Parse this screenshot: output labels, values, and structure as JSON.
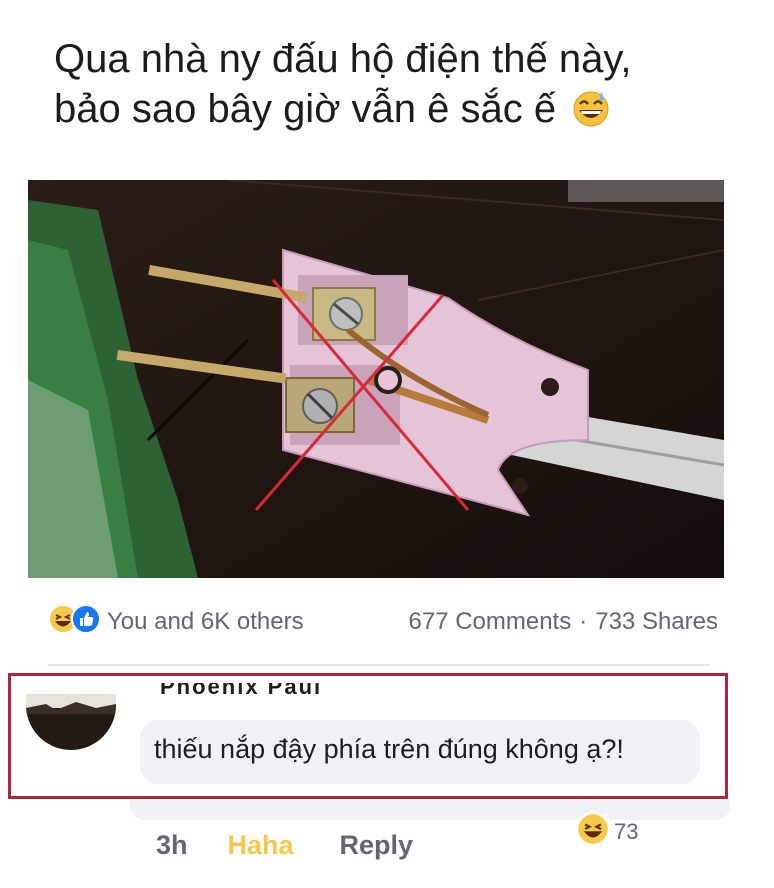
{
  "caption": {
    "line1": "Qua nhà ny đấu hộ điện thế này,",
    "line2": "bảo sao bây giờ vẫn ê sắc ế",
    "emoji": "grinning-sweat-emoji"
  },
  "post": {
    "reactions_summary": "You and 6K others",
    "comments_count": "677 Comments",
    "separator": "·",
    "shares_count": "733 Shares",
    "reaction_icons": [
      "haha-icon",
      "like-icon"
    ]
  },
  "comment": {
    "author": "Phoenix Paul",
    "text": "thiếu nắp đậy phía trên đúng không ạ?!",
    "time": "3h",
    "haha_label": "Haha",
    "reply_label": "Reply",
    "reaction_count": "73"
  },
  "colors": {
    "highlight_frame": "#b3243a",
    "haha_yellow": "#f7c948",
    "like_blue": "#1877f2",
    "cross_red": "#d9283a"
  }
}
